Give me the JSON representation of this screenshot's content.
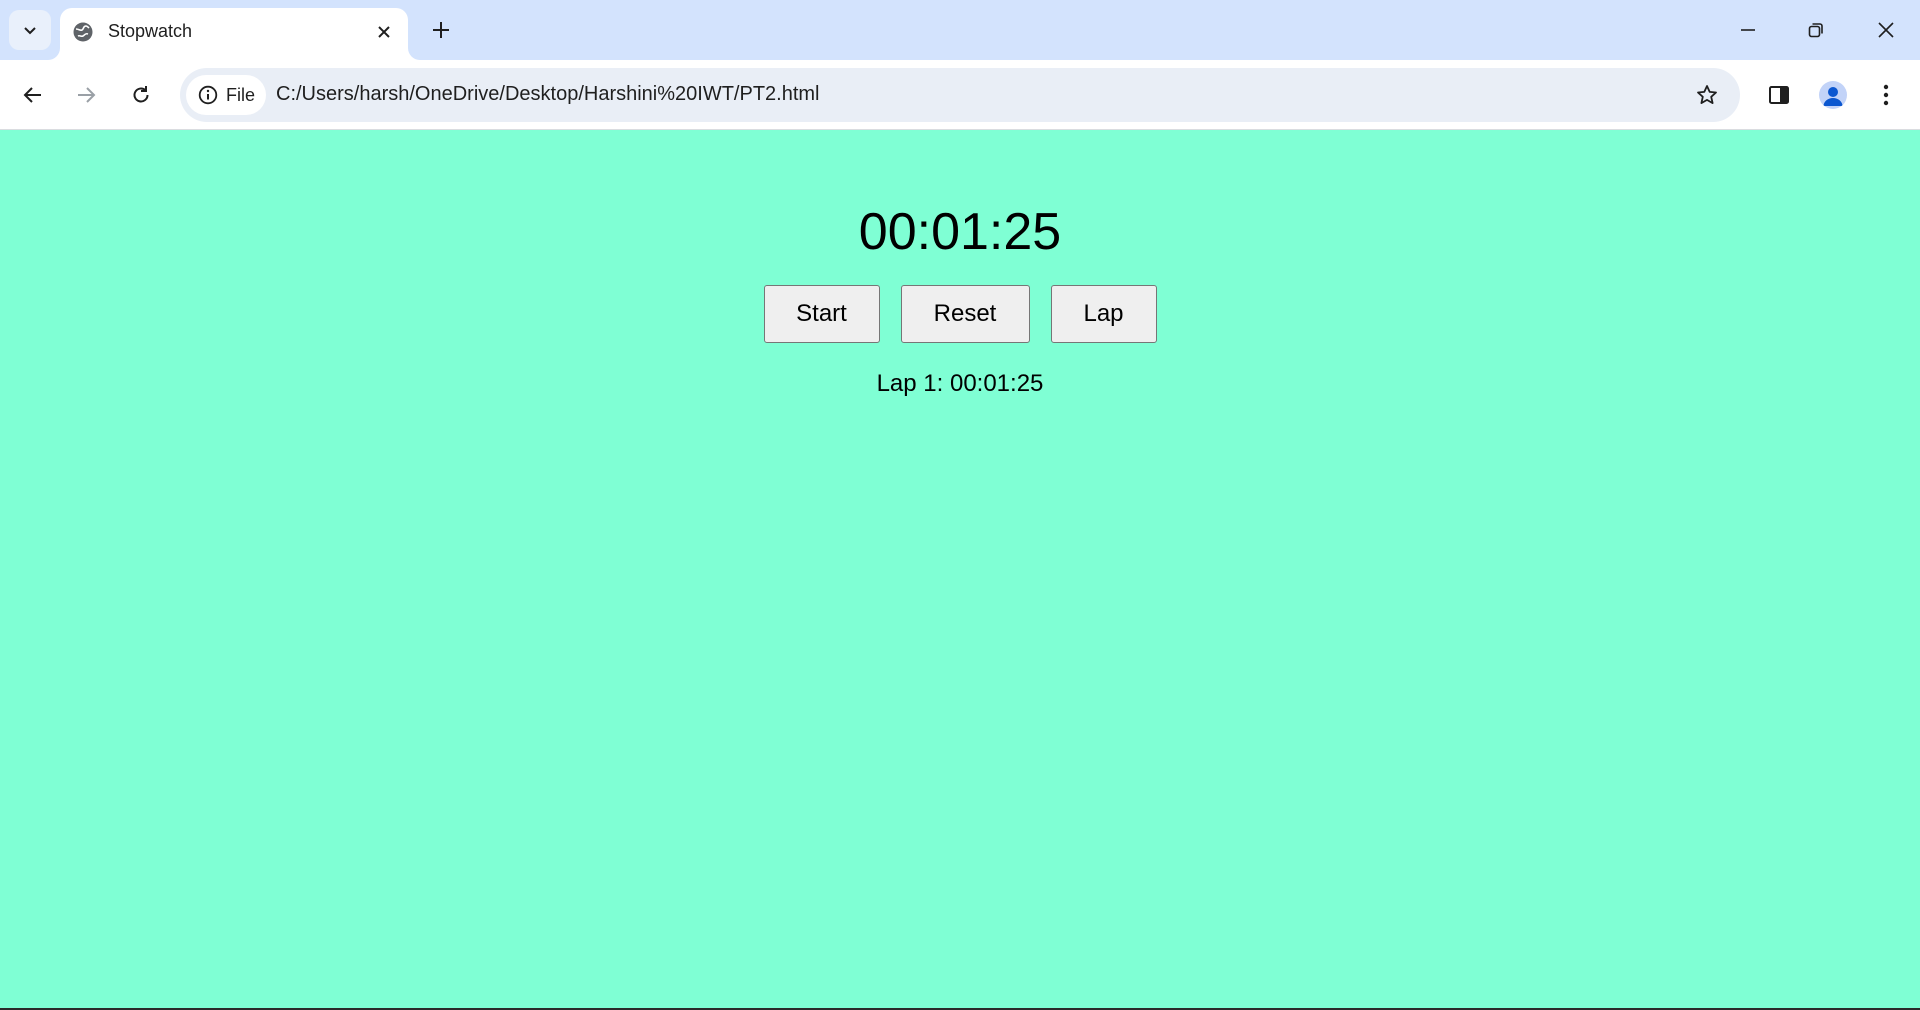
{
  "browser": {
    "tab": {
      "title": "Stopwatch",
      "favicon": "globe-icon"
    },
    "address": {
      "chip_label": "File",
      "url": "C:/Users/harsh/OneDrive/Desktop/Harshini%20IWT/PT2.html"
    },
    "colors": {
      "tabstrip": "#d3e3fd",
      "omnibox": "#e9eef6"
    }
  },
  "stopwatch": {
    "display": "00:01:25",
    "buttons": {
      "start": "Start",
      "reset": "Reset",
      "lap": "Lap"
    },
    "laps": [
      "Lap 1: 00:01:25"
    ],
    "background": "#7fffd4"
  }
}
